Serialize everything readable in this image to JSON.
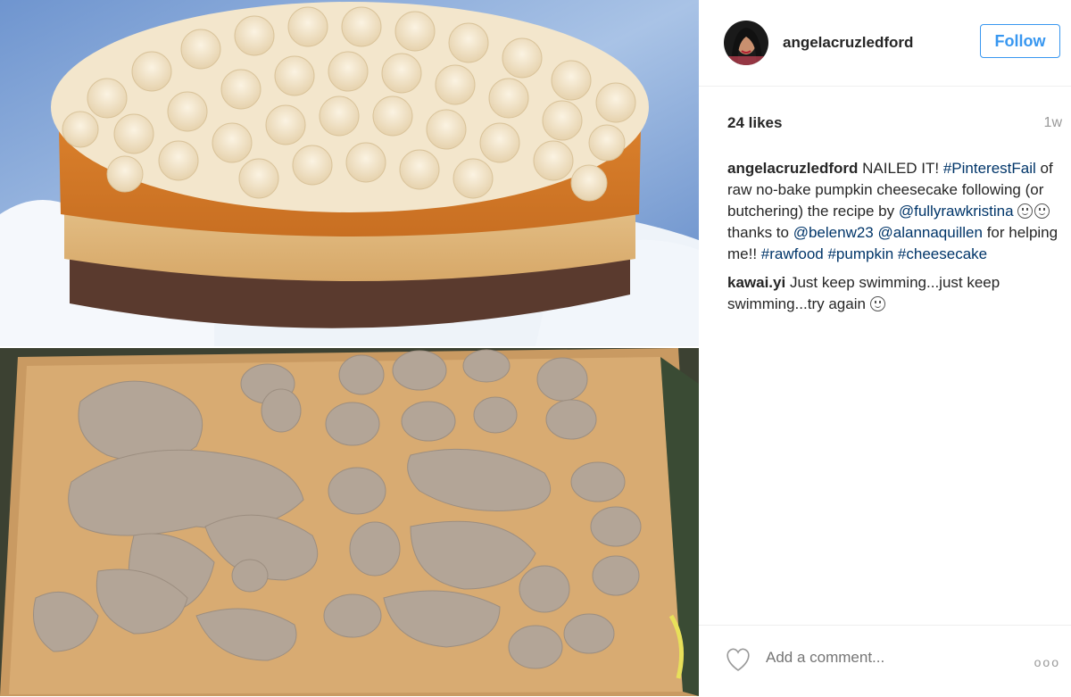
{
  "post": {
    "username": "angelacruzledford",
    "follow_label": "Follow",
    "likes": "24 likes",
    "time": "1w",
    "caption": {
      "user": "angelacruzledford",
      "t1": " NAILED IT! ",
      "h1": "#PinterestFail",
      "t2": " of raw no-bake pumpkin cheesecake following (or butchering) the recipe by ",
      "m1": "@fullyrawkristina",
      "t3": " thanks to ",
      "m2": "@belenw23",
      "t4": " ",
      "m3": "@alannaquillen",
      "t5": " for helping me!! ",
      "h2": "#rawfood",
      "t6": " ",
      "h3": "#pumpkin",
      "t7": " ",
      "h4": "#cheesecake"
    },
    "comment1": {
      "user": "kawai.yi",
      "text": " Just keep swimming...just keep swimming...try again "
    },
    "add_comment_placeholder": "Add a comment...",
    "more_label": "ooo"
  },
  "colors": {
    "accent": "#3897f0",
    "link": "#003569",
    "muted": "#999999"
  },
  "icons": {
    "heart": "heart-outline-icon",
    "more": "more-options-icon",
    "emoji": "smiley-emoji-icon"
  }
}
